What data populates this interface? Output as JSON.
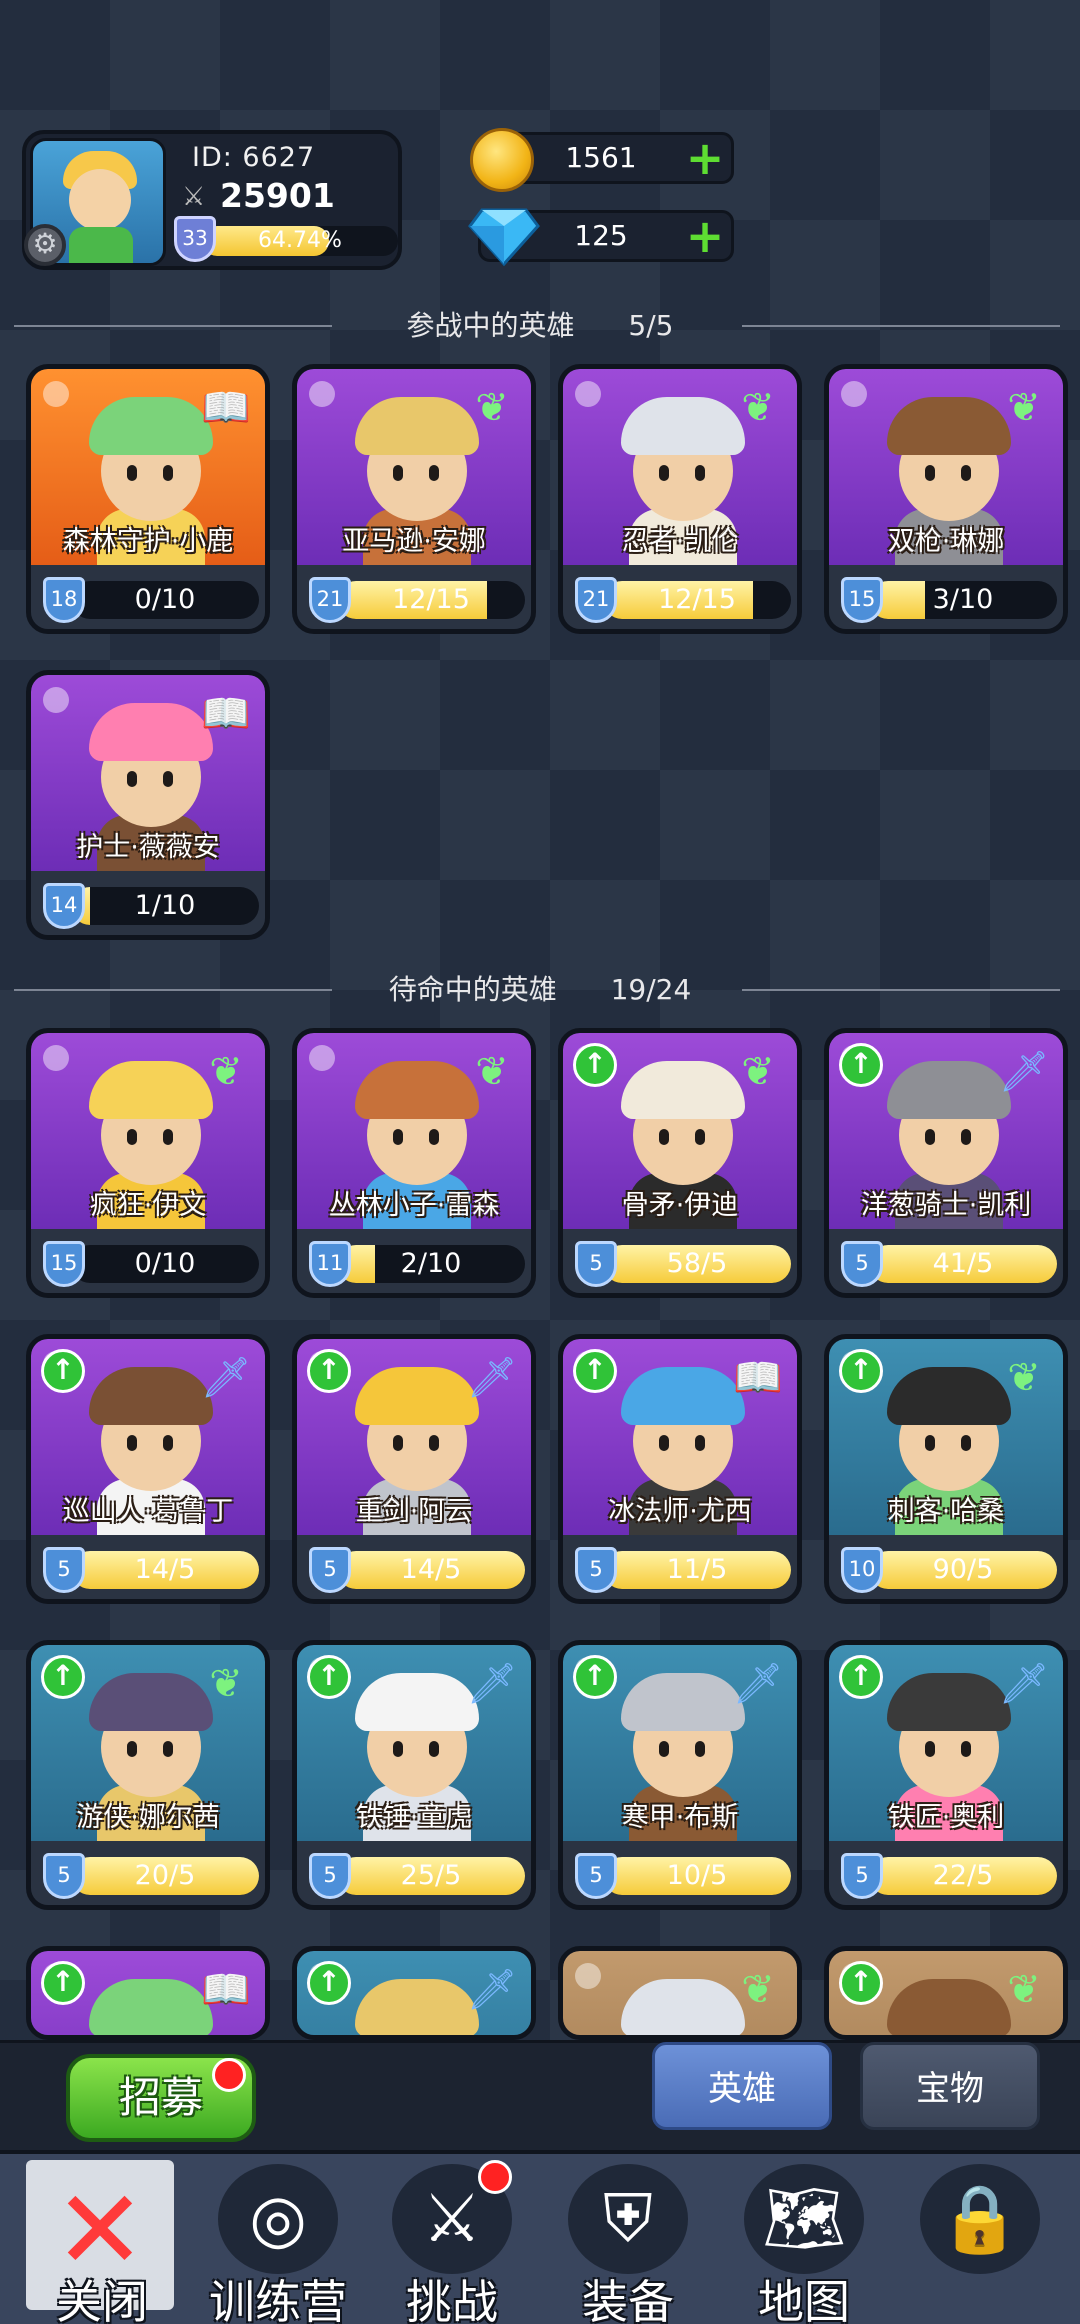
{
  "profile": {
    "id_label": "ID:  6627",
    "power": "25901",
    "level": "33",
    "xp_percent": "64.74%",
    "xp_fraction": 0.6474
  },
  "currency": {
    "gold": "1561",
    "gems": "125"
  },
  "active_section": {
    "title": "参战中的英雄",
    "count": "5/5"
  },
  "reserve_section": {
    "title": "待命中的英雄",
    "count": "19/24"
  },
  "active_heroes": [
    {
      "name": "森林守护·小鹿",
      "level": "18",
      "progress": "0/10",
      "fill": 0,
      "role_icon": "book-icon",
      "bg": "orange"
    },
    {
      "name": "亚马逊·安娜",
      "level": "21",
      "progress": "12/15",
      "fill": 0.8,
      "role_icon": "wing-icon",
      "bg": "purple"
    },
    {
      "name": "忍者·凯伦",
      "level": "21",
      "progress": "12/15",
      "fill": 0.8,
      "role_icon": "wing-icon",
      "bg": "purple"
    },
    {
      "name": "双枪·琳娜",
      "level": "15",
      "progress": "3/10",
      "fill": 0.3,
      "role_icon": "wing-icon",
      "bg": "purple"
    },
    {
      "name": "护士·薇薇安",
      "level": "14",
      "progress": "1/10",
      "fill": 0.1,
      "role_icon": "book-icon",
      "bg": "purple"
    }
  ],
  "reserve_heroes": [
    {
      "name": "疯狂·伊文",
      "level": "15",
      "progress": "0/10",
      "fill": 0,
      "role_icon": "wing-icon",
      "bg": "purple",
      "upgrade": false
    },
    {
      "name": "丛林小子·雷森",
      "level": "11",
      "progress": "2/10",
      "fill": 0.2,
      "role_icon": "wing-icon",
      "bg": "purple",
      "upgrade": false
    },
    {
      "name": "骨矛·伊迪",
      "level": "5",
      "progress": "58/5",
      "fill": 1,
      "role_icon": "wing-icon",
      "bg": "purple",
      "upgrade": true
    },
    {
      "name": "洋葱骑士·凯利",
      "level": "5",
      "progress": "41/5",
      "fill": 1,
      "role_icon": "sword-icon",
      "bg": "purple",
      "upgrade": true
    },
    {
      "name": "巡山人·葛鲁丁",
      "level": "5",
      "progress": "14/5",
      "fill": 1,
      "role_icon": "sword-icon",
      "bg": "purple",
      "upgrade": true
    },
    {
      "name": "重剑·阿云",
      "level": "5",
      "progress": "14/5",
      "fill": 1,
      "role_icon": "sword-icon",
      "bg": "purple",
      "upgrade": true
    },
    {
      "name": "冰法师·尤西",
      "level": "5",
      "progress": "11/5",
      "fill": 1,
      "role_icon": "book-icon",
      "bg": "purple",
      "upgrade": true
    },
    {
      "name": "刺客·哈桑",
      "level": "10",
      "progress": "90/5",
      "fill": 1,
      "role_icon": "wing-icon",
      "bg": "teal",
      "upgrade": true
    },
    {
      "name": "游侠·娜尔茜",
      "level": "5",
      "progress": "20/5",
      "fill": 1,
      "role_icon": "wing-icon",
      "bg": "teal",
      "upgrade": true
    },
    {
      "name": "铁锤·童虎",
      "level": "5",
      "progress": "25/5",
      "fill": 1,
      "role_icon": "sword-icon",
      "bg": "teal",
      "upgrade": true
    },
    {
      "name": "寒甲·布斯",
      "level": "5",
      "progress": "10/5",
      "fill": 1,
      "role_icon": "sword-icon",
      "bg": "teal",
      "upgrade": true
    },
    {
      "name": "铁匠·奥利",
      "level": "5",
      "progress": "22/5",
      "fill": 1,
      "role_icon": "sword-icon",
      "bg": "teal",
      "upgrade": true
    },
    {
      "name": "",
      "level": "",
      "progress": "",
      "fill": 0,
      "role_icon": "book-icon",
      "bg": "purple",
      "upgrade": true
    },
    {
      "name": "",
      "level": "",
      "progress": "",
      "fill": 0,
      "role_icon": "sword-icon",
      "bg": "teal",
      "upgrade": true
    },
    {
      "name": "",
      "level": "",
      "progress": "",
      "fill": 0,
      "role_icon": "wing-icon",
      "bg": "tan",
      "upgrade": false
    },
    {
      "name": "",
      "level": "",
      "progress": "",
      "fill": 0,
      "role_icon": "wing-icon",
      "bg": "tan",
      "upgrade": true
    }
  ],
  "actions": {
    "recruit_label": "招募",
    "tab_heroes": "英雄",
    "tab_treasure": "宝物"
  },
  "nav": [
    {
      "label": "关闭",
      "icon": "close-icon"
    },
    {
      "label": "训练营",
      "icon": "target-icon"
    },
    {
      "label": "挑战",
      "icon": "sword-icon"
    },
    {
      "label": "装备",
      "icon": "armor-icon"
    },
    {
      "label": "地图",
      "icon": "map-icon"
    },
    {
      "label": "",
      "icon": "locked-icon"
    }
  ],
  "colors": {
    "bg_dark": "#232d3e",
    "xp_fill": "#f4c531",
    "plus_green": "#5edd32",
    "active_tab": "#5b80c8",
    "recruit_green": "#4fbf2c"
  }
}
